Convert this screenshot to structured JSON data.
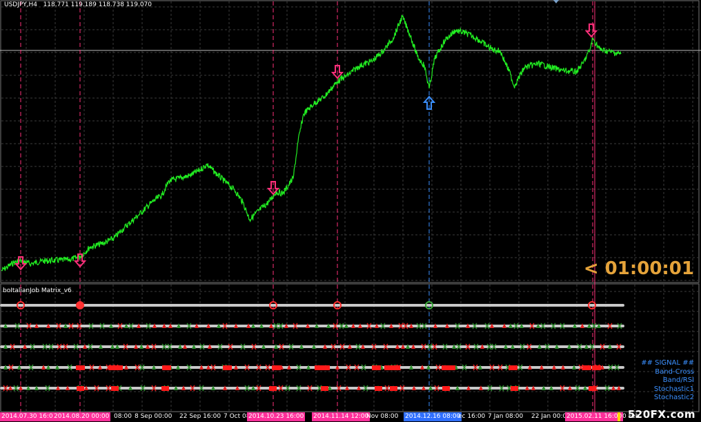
{
  "chart_header": {
    "symbol_label": "USDJPY,H4",
    "ohlc": "118.771 119.189 118.738 119.070"
  },
  "timer": "< 01:00:01",
  "indicator": {
    "title": "boItalianJob Matrix_v6",
    "legend": [
      "## SIGNAL ##",
      "Band-Cross",
      "Band/RSI",
      "Stochastic1",
      "Stochastic2"
    ]
  },
  "watermark": "520FX.com",
  "time_axis": [
    {
      "label": "2014.07.30 16:00",
      "style": "pink"
    },
    {
      "label": "2014.08.20 00:00",
      "style": "pink"
    },
    {
      "label": "08:00",
      "style": "plain"
    },
    {
      "label": "8 Sep 00:00",
      "style": "plain"
    },
    {
      "label": "22 Sep 16:00",
      "style": "plain"
    },
    {
      "label": "7 Oct 08",
      "style": "plain"
    },
    {
      "label": "2014.10.23 16:00",
      "style": "pink"
    },
    {
      "label": "2014.11.14 12:00",
      "style": "pink"
    },
    {
      "label": "Nov 08:00",
      "style": "plain"
    },
    {
      "label": "2014.12.16 08:00",
      "style": "blue"
    },
    {
      "label": "ec 16:00",
      "style": "plain"
    },
    {
      "label": "7 Jan 08:00",
      "style": "plain"
    },
    {
      "label": "22 Jan 00:00",
      "style": "plain"
    },
    {
      "label": "2015.02.11 16:00",
      "style": "pink"
    },
    {
      "label": "0 Feb",
      "style": "plain"
    }
  ],
  "colors": {
    "price": "#22ee22",
    "grid": "#3c3c3c",
    "pink_line": "#ff2f7a",
    "blue_line": "#3a8fff",
    "timer": "#e5a33a",
    "rail": "#c8c8c8"
  }
}
